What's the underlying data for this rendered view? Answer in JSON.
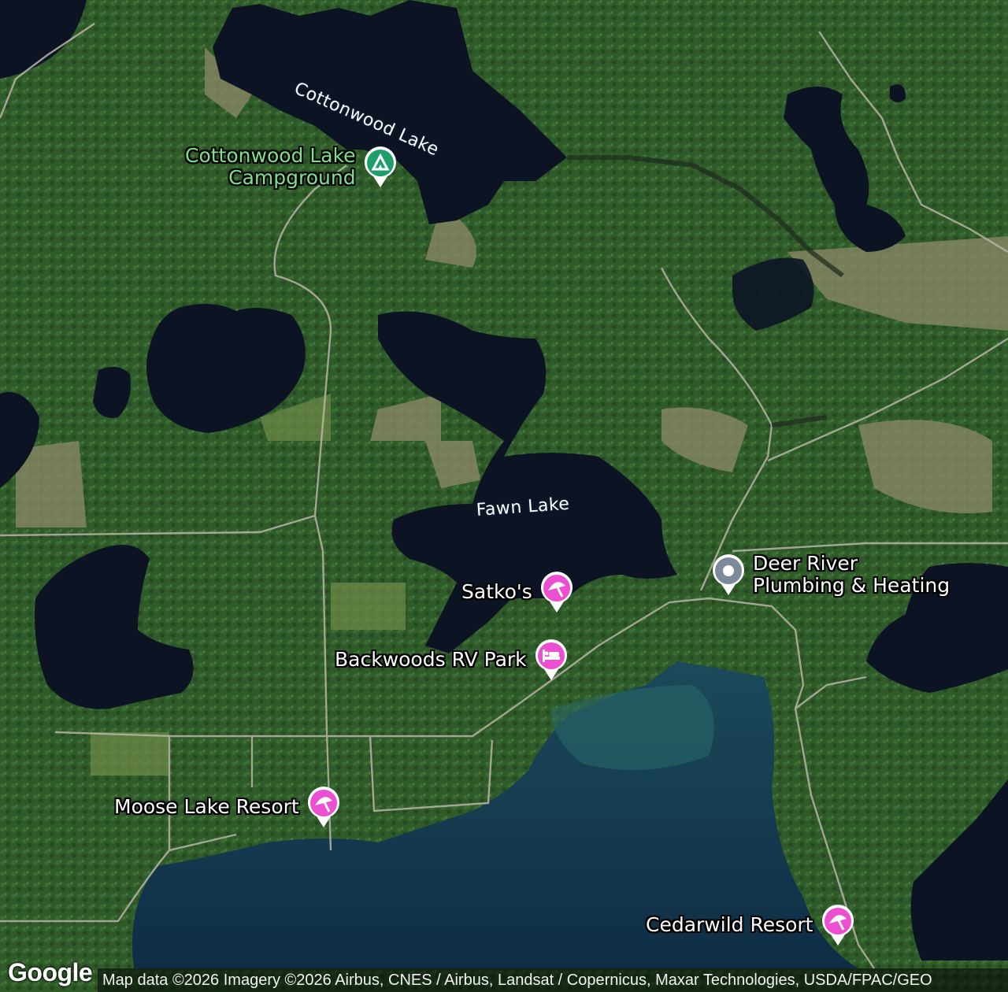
{
  "map": {
    "lakes": [
      {
        "name": "Cottonwood Lake"
      },
      {
        "name": "Fawn Lake"
      }
    ],
    "pois": [
      {
        "label": "Cottonwood Lake\nCampground",
        "icon": "campground-icon",
        "color": "#1e9e6a"
      },
      {
        "label": "Satko's",
        "icon": "resort-icon",
        "color": "#ec4fd0"
      },
      {
        "label": "Backwoods RV Park",
        "icon": "lodging-icon",
        "color": "#ec4fd0"
      },
      {
        "label": "Moose Lake Resort",
        "icon": "resort-icon",
        "color": "#ec4fd0"
      },
      {
        "label": "Cedarwild Resort",
        "icon": "resort-icon",
        "color": "#ec4fd0"
      },
      {
        "label": "Deer River\nPlumbing & Heating",
        "icon": "business-pin-icon",
        "color": "#7d8a99"
      }
    ],
    "branding": "Google",
    "attribution": "Map data ©2026 Imagery ©2026 Airbus, CNES / Airbus, Landsat / Copernicus, Maxar Technologies, USDA/FPAC/GEO"
  },
  "colors": {
    "forest": "#2f5a2a",
    "water": "#0c1424",
    "lake_water": "#123246",
    "marsh": "#8f8a6a"
  }
}
